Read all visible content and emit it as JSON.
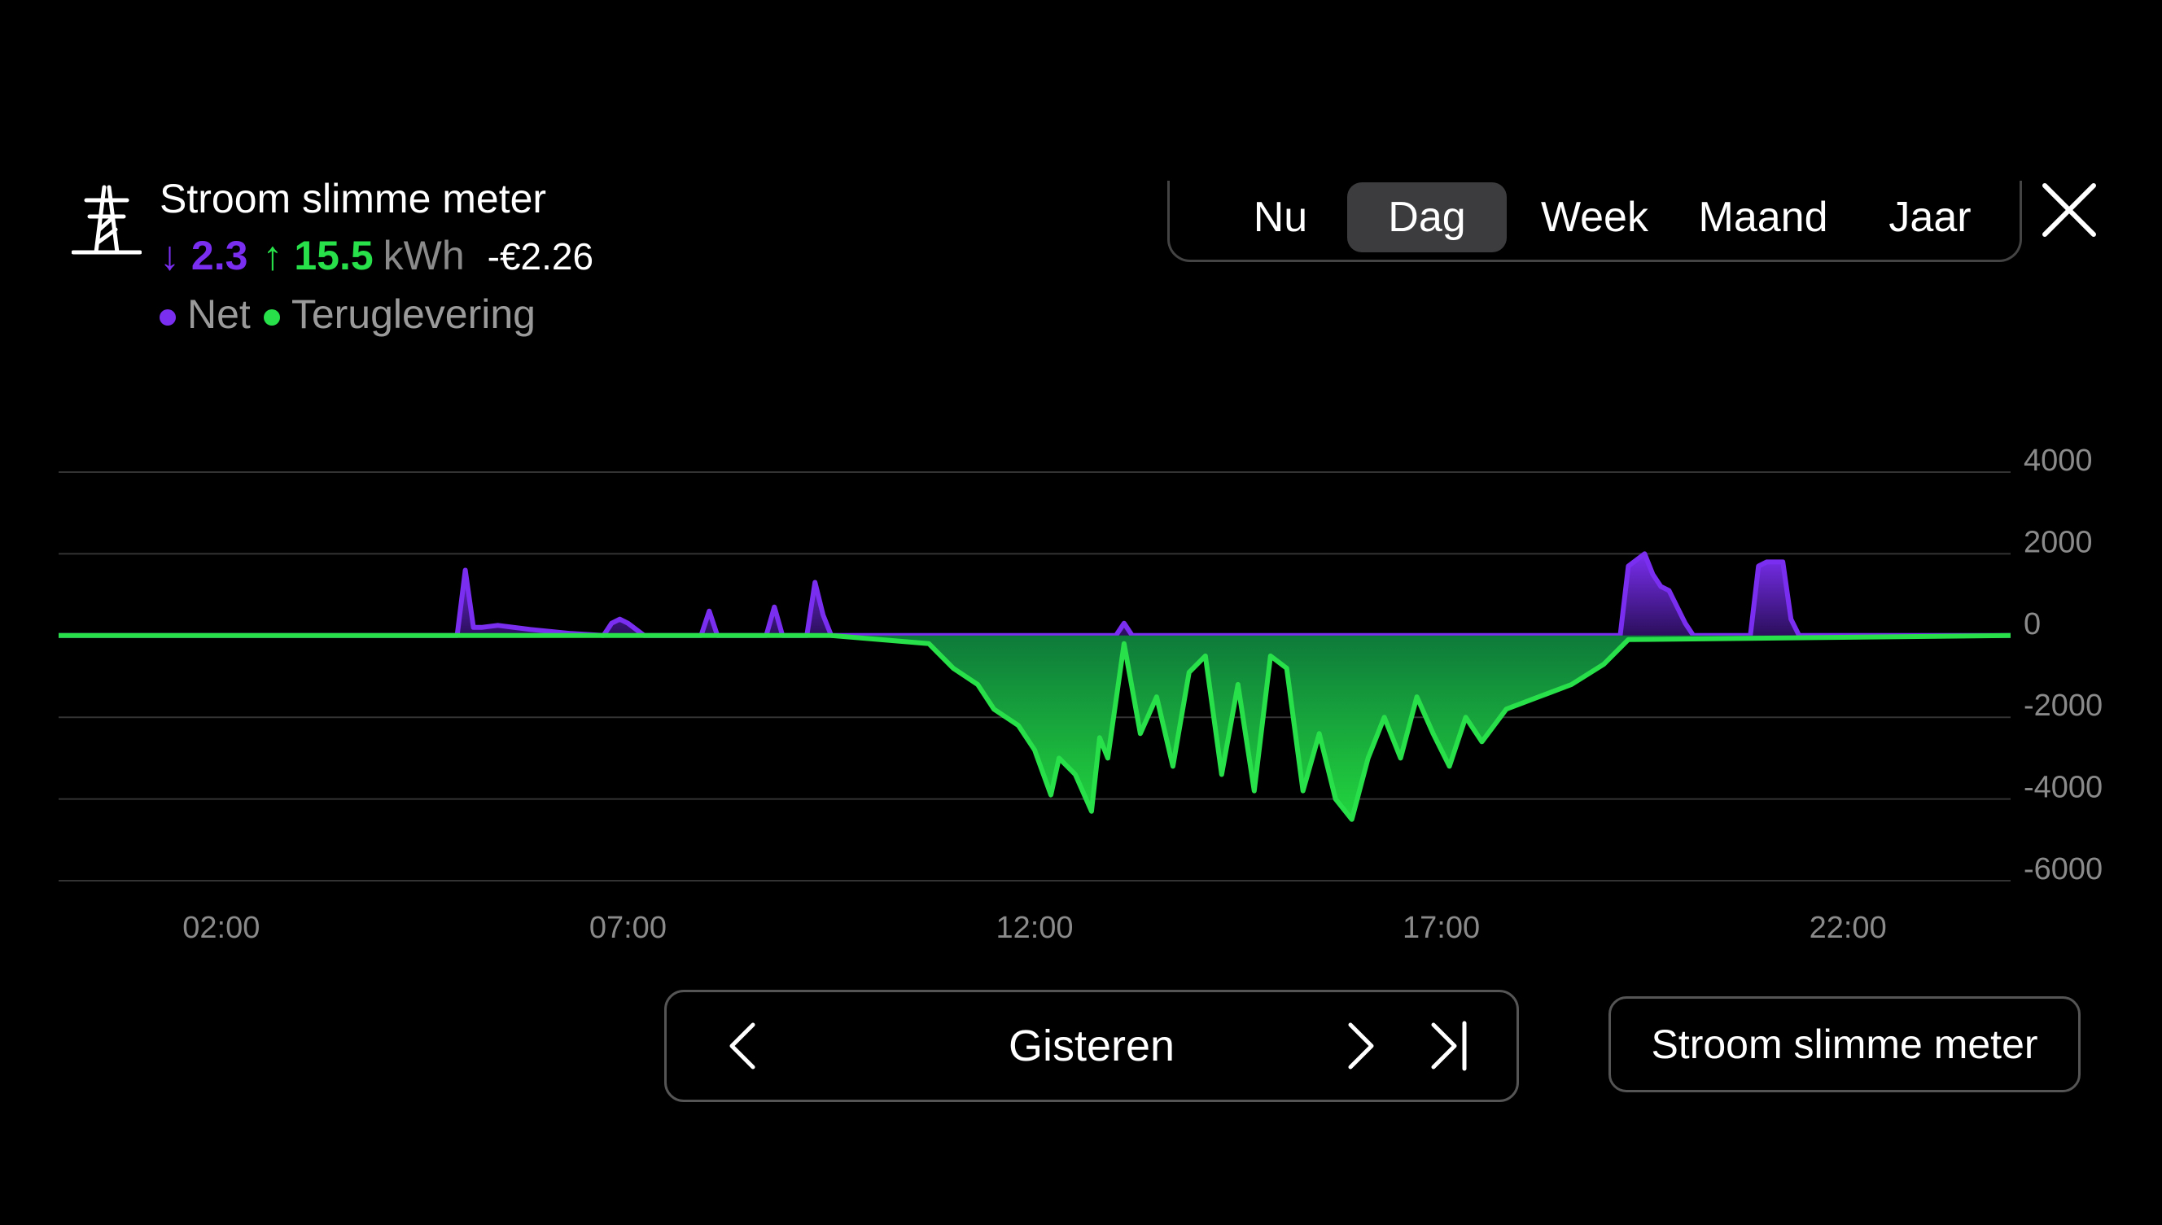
{
  "header": {
    "title": "Stroom slimme meter",
    "import_arrow": "↓",
    "import_value": "2.3",
    "export_arrow": "↑",
    "export_value": "15.5",
    "unit": "kWh",
    "cost": "-€2.26",
    "legend_net": "Net",
    "legend_export": "Teruglevering",
    "icon": "power-pylon-icon"
  },
  "tabs": [
    {
      "label": "Nu",
      "active": false
    },
    {
      "label": "Dag",
      "active": true
    },
    {
      "label": "Week",
      "active": false
    },
    {
      "label": "Maand",
      "active": false
    },
    {
      "label": "Jaar",
      "active": false
    }
  ],
  "close_icon": "close-icon",
  "navigation": {
    "label": "Gisteren",
    "prev_icon": "chevron-left-icon",
    "next_icon": "chevron-right-icon",
    "last_icon": "skip-to-end-icon"
  },
  "source_button": "Stroom slimme meter",
  "colors": {
    "net": "#7a2ef0",
    "export": "#28e04a",
    "grid": "#333333",
    "tick": "#8a8a8a",
    "active_tab": "#3c3c3e"
  },
  "chart_data": {
    "type": "area",
    "ylim": [
      -6000,
      4000
    ],
    "yticks": [
      4000,
      2000,
      0,
      -2000,
      -4000,
      -6000
    ],
    "xlim": [
      -2,
      22
    ],
    "xticks": [
      {
        "x": 0,
        "label": "02:00"
      },
      {
        "x": 5,
        "label": "07:00"
      },
      {
        "x": 10,
        "label": "12:00"
      },
      {
        "x": 15,
        "label": "17:00"
      },
      {
        "x": 20,
        "label": "22:00"
      }
    ],
    "series": [
      {
        "name": "Net",
        "x": [
          -2,
          1.5,
          2.9,
          3.0,
          3.1,
          3.2,
          3.4,
          3.8,
          4.3,
          4.7,
          4.8,
          4.9,
          5.0,
          5.2,
          5.9,
          6.0,
          6.1,
          6.2,
          6.7,
          6.8,
          6.9,
          7.2,
          7.3,
          7.4,
          7.5,
          9.0,
          11.0,
          11.1,
          11.2,
          17.2,
          17.3,
          17.5,
          17.6,
          17.7,
          17.8,
          18.0,
          18.1,
          18.8,
          18.9,
          19.0,
          19.2,
          19.3,
          19.4,
          22
        ],
        "y": [
          0,
          0,
          0,
          1600,
          200,
          200,
          250,
          150,
          50,
          0,
          300,
          400,
          300,
          0,
          0,
          600,
          0,
          0,
          0,
          700,
          0,
          0,
          1300,
          500,
          0,
          0,
          0,
          300,
          0,
          0,
          1700,
          2000,
          1500,
          1200,
          1100,
          300,
          0,
          0,
          1700,
          1800,
          1800,
          400,
          0,
          0
        ]
      },
      {
        "name": "Teruglevering",
        "x": [
          -2,
          7.5,
          8.7,
          9.0,
          9.3,
          9.5,
          9.8,
          10.0,
          10.2,
          10.3,
          10.5,
          10.7,
          10.8,
          10.9,
          11.1,
          11.3,
          11.5,
          11.7,
          11.9,
          12.1,
          12.3,
          12.5,
          12.7,
          12.9,
          13.1,
          13.3,
          13.5,
          13.7,
          13.9,
          14.1,
          14.3,
          14.5,
          14.7,
          14.9,
          15.1,
          15.3,
          15.5,
          15.8,
          16.2,
          16.6,
          17.0,
          17.3,
          22
        ],
        "y": [
          0,
          0,
          -200,
          -800,
          -1200,
          -1800,
          -2200,
          -2800,
          -3900,
          -3000,
          -3400,
          -4300,
          -2500,
          -3000,
          -200,
          -2400,
          -1500,
          -3200,
          -900,
          -500,
          -3400,
          -1200,
          -3800,
          -500,
          -800,
          -3800,
          -2400,
          -4000,
          -4500,
          -3000,
          -2000,
          -3000,
          -1500,
          -2400,
          -3200,
          -2000,
          -2600,
          -1800,
          -1500,
          -1200,
          -700,
          -100,
          0
        ]
      }
    ]
  }
}
